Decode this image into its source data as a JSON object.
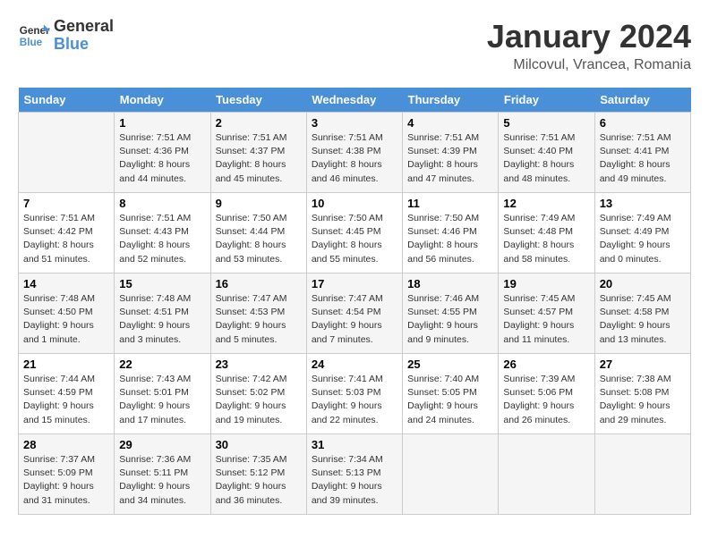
{
  "header": {
    "logo_line1": "General",
    "logo_line2": "Blue",
    "month": "January 2024",
    "location": "Milcovul, Vrancea, Romania"
  },
  "weekdays": [
    "Sunday",
    "Monday",
    "Tuesday",
    "Wednesday",
    "Thursday",
    "Friday",
    "Saturday"
  ],
  "weeks": [
    [
      {
        "day": "",
        "info": ""
      },
      {
        "day": "1",
        "info": "Sunrise: 7:51 AM\nSunset: 4:36 PM\nDaylight: 8 hours\nand 44 minutes."
      },
      {
        "day": "2",
        "info": "Sunrise: 7:51 AM\nSunset: 4:37 PM\nDaylight: 8 hours\nand 45 minutes."
      },
      {
        "day": "3",
        "info": "Sunrise: 7:51 AM\nSunset: 4:38 PM\nDaylight: 8 hours\nand 46 minutes."
      },
      {
        "day": "4",
        "info": "Sunrise: 7:51 AM\nSunset: 4:39 PM\nDaylight: 8 hours\nand 47 minutes."
      },
      {
        "day": "5",
        "info": "Sunrise: 7:51 AM\nSunset: 4:40 PM\nDaylight: 8 hours\nand 48 minutes."
      },
      {
        "day": "6",
        "info": "Sunrise: 7:51 AM\nSunset: 4:41 PM\nDaylight: 8 hours\nand 49 minutes."
      }
    ],
    [
      {
        "day": "7",
        "info": "Sunrise: 7:51 AM\nSunset: 4:42 PM\nDaylight: 8 hours\nand 51 minutes."
      },
      {
        "day": "8",
        "info": "Sunrise: 7:51 AM\nSunset: 4:43 PM\nDaylight: 8 hours\nand 52 minutes."
      },
      {
        "day": "9",
        "info": "Sunrise: 7:50 AM\nSunset: 4:44 PM\nDaylight: 8 hours\nand 53 minutes."
      },
      {
        "day": "10",
        "info": "Sunrise: 7:50 AM\nSunset: 4:45 PM\nDaylight: 8 hours\nand 55 minutes."
      },
      {
        "day": "11",
        "info": "Sunrise: 7:50 AM\nSunset: 4:46 PM\nDaylight: 8 hours\nand 56 minutes."
      },
      {
        "day": "12",
        "info": "Sunrise: 7:49 AM\nSunset: 4:48 PM\nDaylight: 8 hours\nand 58 minutes."
      },
      {
        "day": "13",
        "info": "Sunrise: 7:49 AM\nSunset: 4:49 PM\nDaylight: 9 hours\nand 0 minutes."
      }
    ],
    [
      {
        "day": "14",
        "info": "Sunrise: 7:48 AM\nSunset: 4:50 PM\nDaylight: 9 hours\nand 1 minute."
      },
      {
        "day": "15",
        "info": "Sunrise: 7:48 AM\nSunset: 4:51 PM\nDaylight: 9 hours\nand 3 minutes."
      },
      {
        "day": "16",
        "info": "Sunrise: 7:47 AM\nSunset: 4:53 PM\nDaylight: 9 hours\nand 5 minutes."
      },
      {
        "day": "17",
        "info": "Sunrise: 7:47 AM\nSunset: 4:54 PM\nDaylight: 9 hours\nand 7 minutes."
      },
      {
        "day": "18",
        "info": "Sunrise: 7:46 AM\nSunset: 4:55 PM\nDaylight: 9 hours\nand 9 minutes."
      },
      {
        "day": "19",
        "info": "Sunrise: 7:45 AM\nSunset: 4:57 PM\nDaylight: 9 hours\nand 11 minutes."
      },
      {
        "day": "20",
        "info": "Sunrise: 7:45 AM\nSunset: 4:58 PM\nDaylight: 9 hours\nand 13 minutes."
      }
    ],
    [
      {
        "day": "21",
        "info": "Sunrise: 7:44 AM\nSunset: 4:59 PM\nDaylight: 9 hours\nand 15 minutes."
      },
      {
        "day": "22",
        "info": "Sunrise: 7:43 AM\nSunset: 5:01 PM\nDaylight: 9 hours\nand 17 minutes."
      },
      {
        "day": "23",
        "info": "Sunrise: 7:42 AM\nSunset: 5:02 PM\nDaylight: 9 hours\nand 19 minutes."
      },
      {
        "day": "24",
        "info": "Sunrise: 7:41 AM\nSunset: 5:03 PM\nDaylight: 9 hours\nand 22 minutes."
      },
      {
        "day": "25",
        "info": "Sunrise: 7:40 AM\nSunset: 5:05 PM\nDaylight: 9 hours\nand 24 minutes."
      },
      {
        "day": "26",
        "info": "Sunrise: 7:39 AM\nSunset: 5:06 PM\nDaylight: 9 hours\nand 26 minutes."
      },
      {
        "day": "27",
        "info": "Sunrise: 7:38 AM\nSunset: 5:08 PM\nDaylight: 9 hours\nand 29 minutes."
      }
    ],
    [
      {
        "day": "28",
        "info": "Sunrise: 7:37 AM\nSunset: 5:09 PM\nDaylight: 9 hours\nand 31 minutes."
      },
      {
        "day": "29",
        "info": "Sunrise: 7:36 AM\nSunset: 5:11 PM\nDaylight: 9 hours\nand 34 minutes."
      },
      {
        "day": "30",
        "info": "Sunrise: 7:35 AM\nSunset: 5:12 PM\nDaylight: 9 hours\nand 36 minutes."
      },
      {
        "day": "31",
        "info": "Sunrise: 7:34 AM\nSunset: 5:13 PM\nDaylight: 9 hours\nand 39 minutes."
      },
      {
        "day": "",
        "info": ""
      },
      {
        "day": "",
        "info": ""
      },
      {
        "day": "",
        "info": ""
      }
    ]
  ]
}
